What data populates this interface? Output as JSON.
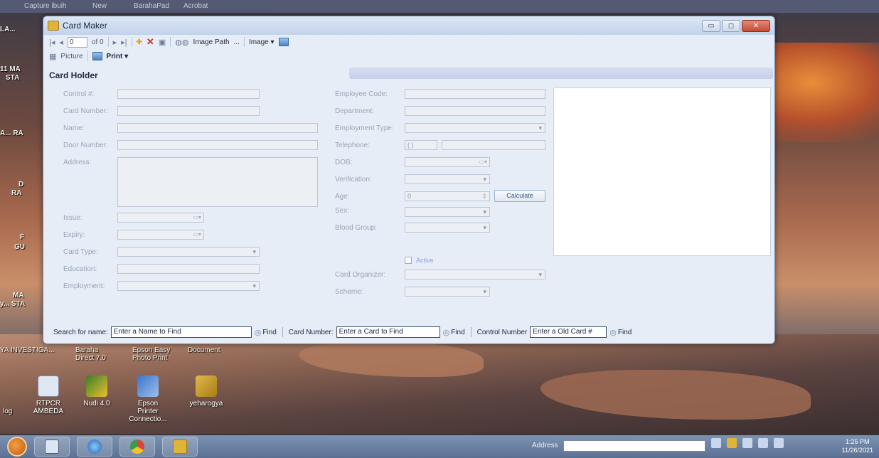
{
  "desktop": {
    "top_strip": [
      "Capture ibuih",
      "New",
      "BarahaPad",
      "Acrobat"
    ],
    "left_labels": [
      {
        "text": "LA..."
      },
      {
        "text": "11 MA"
      },
      {
        "text": "STA"
      },
      {
        "text": "A... RA"
      },
      {
        "text": "D"
      },
      {
        "text": "RA"
      },
      {
        "text": "F"
      },
      {
        "text": "GU"
      },
      {
        "text": "MA"
      },
      {
        "text": "y... STA"
      }
    ],
    "row_labels": [
      "YA INVESTIGA...",
      "Baraha Direct 7.0",
      "Epson Easy Photo Print",
      "Document"
    ],
    "icons": [
      {
        "label": "RTPCR AMBEDA",
        "icon": "document-icon"
      },
      {
        "label": "Nudi 4.0",
        "icon": "nudi-icon"
      },
      {
        "label": "Epson Printer Connectio...",
        "icon": "printer-icon"
      },
      {
        "label": "yeharogya",
        "icon": "folder-icon"
      }
    ],
    "extra_label": "log"
  },
  "window": {
    "title": "Card Maker",
    "controls": {
      "minimize": "▭",
      "maximize": "◻",
      "close": "✕"
    }
  },
  "toolbar": {
    "nav_first": "|◂",
    "nav_prev": "◂",
    "position_value": "0",
    "of_label": "of 0",
    "nav_next": "▸",
    "nav_last": "▸|",
    "image_path": "Image Path",
    "ellipsis": "...",
    "image_dropdown": "Image ▾",
    "picture": "Picture",
    "print": "Print ▾"
  },
  "section": {
    "title": "Card Holder"
  },
  "form": {
    "left": {
      "control_no": "Control #:",
      "card_number": "Card Number:",
      "name": "Name:",
      "door_number": "Door Number:",
      "address": "Address:",
      "issue": "Issue:",
      "expiry": "Expiry:",
      "card_type": "Card Type:",
      "education": "Education:",
      "employment": "Employment:"
    },
    "right": {
      "employee_code": "Employee Code:",
      "department": "Department:",
      "employment_type": "Employment Type:",
      "telephone": "Telephone:",
      "telephone_area": "(   )",
      "dob": "DOB:",
      "verification": "Verification:",
      "age": "Age:",
      "age_value": "0",
      "calculate": "Calculate",
      "sex": "Sex:",
      "blood_group": "Blood Group:",
      "active": "Active",
      "card_organizer": "Card Organizer:",
      "scheme": "Scheme:"
    }
  },
  "search": {
    "name_label": "Search for name:",
    "name_value": "Enter a Name to Find",
    "find": "Find",
    "card_label": "Card Number:",
    "card_value": "Enter a Card to Find",
    "control_label": "Control Number",
    "control_value": "Enter a Old Card #"
  },
  "taskbar": {
    "address_label": "Address",
    "time": "1:25 PM",
    "date": "11/26/2021"
  },
  "colors": {
    "window_bg": "#e6edf6",
    "title_gradient": "#c3d3ea",
    "close_red": "#c44a34",
    "taskbar": "#5b7093"
  }
}
